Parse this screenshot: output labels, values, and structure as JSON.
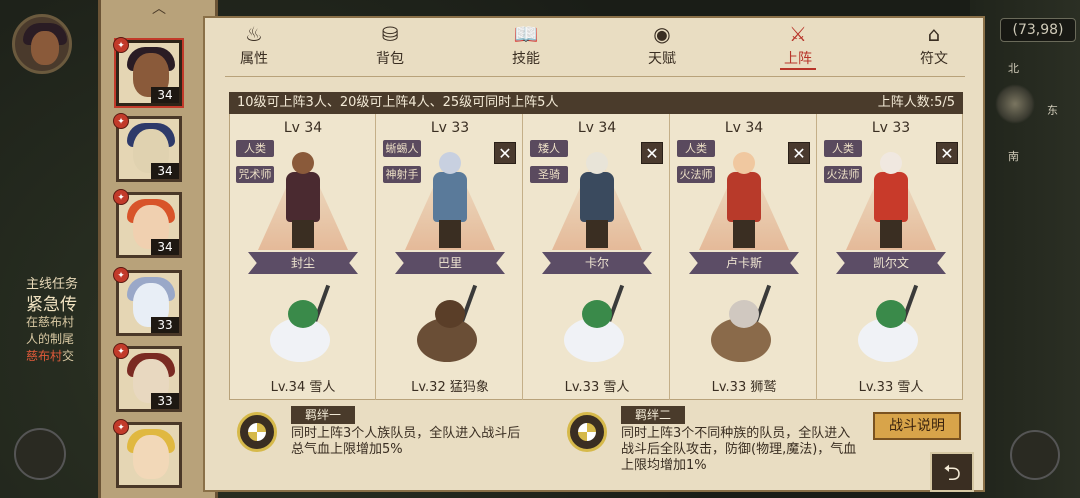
{
  "coords": "(73,98)",
  "compass": {
    "north": "北",
    "east": "东",
    "south": "南"
  },
  "quest": {
    "title": "主线任务",
    "heading": "紧急传",
    "line1": "在慈布村",
    "line2": "人的制尾",
    "line3_hl": "慈布村",
    "line3_rest": "交"
  },
  "portraits": [
    {
      "level": "34",
      "hair": "#2a1c24",
      "face": "#8a5a3a"
    },
    {
      "level": "34",
      "hair": "#2e3a6a",
      "face": "#e0d2b0"
    },
    {
      "level": "34",
      "hair": "#d8542a",
      "face": "#f0d0b0"
    },
    {
      "level": "33",
      "hair": "#9aa8c8",
      "face": "#e8eef6"
    },
    {
      "level": "33",
      "hair": "#7a2a22",
      "face": "#e8d8c0"
    },
    {
      "level": "",
      "hair": "#e0b840",
      "face": "#f2d8b8"
    }
  ],
  "tabs": [
    {
      "label": "属性",
      "icon": "flame-icon",
      "glyph": "♨"
    },
    {
      "label": "背包",
      "icon": "backpack-icon",
      "glyph": "⛁"
    },
    {
      "label": "技能",
      "icon": "book-icon",
      "glyph": "📖"
    },
    {
      "label": "天赋",
      "icon": "eye-icon",
      "glyph": "◉"
    },
    {
      "label": "上阵",
      "icon": "crossed-swords-icon",
      "glyph": "⚔"
    },
    {
      "label": "符文",
      "icon": "rune-icon",
      "glyph": "⌂"
    }
  ],
  "lineup": {
    "rule": "10级可上阵3人、20级可上阵4人、25级可同时上阵5人",
    "count_label": "上阵人数:5/5"
  },
  "heroes": [
    {
      "level": "Lv 34",
      "race": "人类",
      "class": "咒术师",
      "name": "封尘",
      "body": "#4a2a30",
      "head": "#8a5a3a",
      "removable": false,
      "pet": "Lv.34 雪人",
      "pet_body": "#f0f2f6",
      "pet_head": "#3a8a4a"
    },
    {
      "level": "Lv 33",
      "race": "蜥蜴人",
      "class": "神射手",
      "name": "巴里",
      "body": "#5a7a9a",
      "head": "#c8d0e0",
      "removable": true,
      "pet": "Lv.32 猛犸象",
      "pet_body": "#6a4e36",
      "pet_head": "#5a3e28"
    },
    {
      "level": "Lv 34",
      "race": "矮人",
      "class": "圣骑",
      "name": "卡尔",
      "body": "#3a4a5e",
      "head": "#e8e4d8",
      "removable": true,
      "pet": "Lv.33 雪人",
      "pet_body": "#f0f2f6",
      "pet_head": "#3a8a4a"
    },
    {
      "level": "Lv 34",
      "race": "人类",
      "class": "火法师",
      "name": "卢卡斯",
      "body": "#b83a2a",
      "head": "#f0c8a0",
      "removable": true,
      "pet": "Lv.33 狮鹫",
      "pet_body": "#8a6a4a",
      "pet_head": "#d0c8c0"
    },
    {
      "level": "Lv 33",
      "race": "人类",
      "class": "火法师",
      "name": "凯尔文",
      "body": "#c83a2a",
      "head": "#f0e8e0",
      "removable": true,
      "pet": "Lv.33 雪人",
      "pet_body": "#f0f2f6",
      "pet_head": "#3a8a4a"
    }
  ],
  "bonds": [
    {
      "title": "羁绊一",
      "line1": "同时上阵3个人族队员，全队进入战斗后",
      "line2": "总气血上限增加5%",
      "line3": ""
    },
    {
      "title": "羁绊二",
      "line1": "同时上阵3个不同种族的队员，全队进入",
      "line2": "战斗后全队攻击，防御(物理,魔法)，气血",
      "line3": "上限均增加1%"
    }
  ],
  "battle_button": "战斗说明",
  "back_glyph": "⮌"
}
